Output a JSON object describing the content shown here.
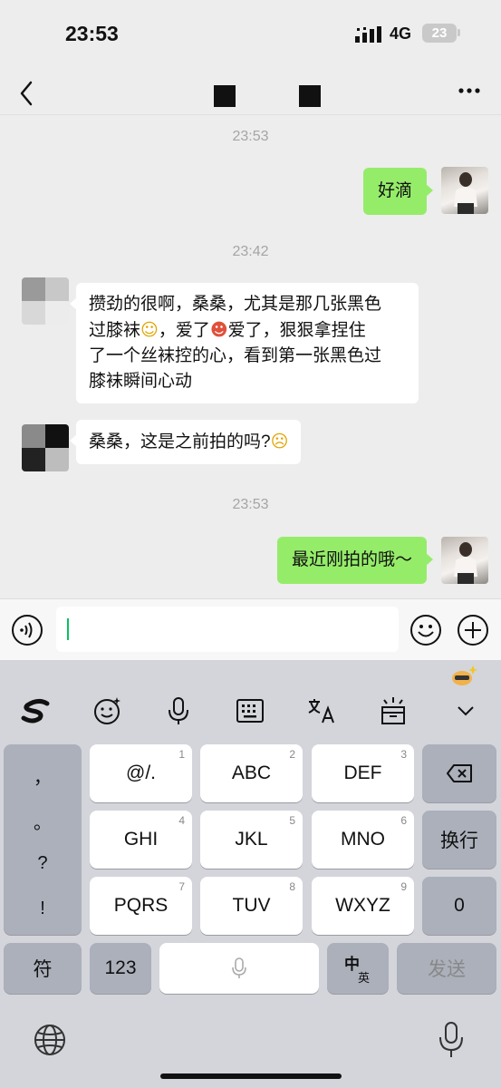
{
  "status_bar": {
    "time": "23:53",
    "network": "4G",
    "battery": "23"
  },
  "nav": {
    "back_label": "back",
    "more_label": "more"
  },
  "messages": [
    {
      "type": "timestamp",
      "text": "23:53"
    },
    {
      "type": "me",
      "text": "好滴"
    },
    {
      "type": "timestamp",
      "text": "23:42"
    },
    {
      "type": "other",
      "lines": [
        "攒劲的很啊，桑桑，尤其是那几张黑色",
        "过膝袜",
        "，爱了",
        "爱了，狠狠拿捏住",
        "了一个丝袜控的心，看到第一张黑色过",
        "膝袜瞬间心动"
      ]
    },
    {
      "type": "other",
      "text": "桑桑，这是之前拍的吗?"
    },
    {
      "type": "timestamp",
      "text": "23:53"
    },
    {
      "type": "me",
      "text": "最近刚拍的哦～"
    }
  ],
  "input": {
    "value": ""
  },
  "keyboard": {
    "punctuation": [
      "，",
      "。",
      "?",
      "!"
    ],
    "rows": [
      [
        {
          "label": "@/.",
          "num": "1"
        },
        {
          "label": "ABC",
          "num": "2"
        },
        {
          "label": "DEF",
          "num": "3"
        }
      ],
      [
        {
          "label": "GHI",
          "num": "4"
        },
        {
          "label": "JKL",
          "num": "5"
        },
        {
          "label": "MNO",
          "num": "6"
        }
      ],
      [
        {
          "label": "PQRS",
          "num": "7"
        },
        {
          "label": "TUV",
          "num": "8"
        },
        {
          "label": "WXYZ",
          "num": "9"
        }
      ]
    ],
    "newline": "换行",
    "zero": "0",
    "symbols": "符",
    "numbers": "123",
    "lang_main": "中",
    "lang_sub": "英",
    "send": "发送"
  },
  "colors": {
    "me_bubble": "#95ec69",
    "other_bubble": "#ffffff",
    "accent": "#07c160",
    "keyboard_bg": "#d3d5db"
  },
  "icons": [
    "back-icon",
    "more-icon",
    "voice-icon",
    "emoji-icon",
    "plus-icon",
    "sogou-logo-icon",
    "keyboard-emoji-icon",
    "mic-icon",
    "keyboard-layout-icon",
    "translate-icon",
    "clipboard-icon",
    "collapse-chevron-icon",
    "backspace-icon",
    "globe-icon",
    "dictation-icon"
  ]
}
